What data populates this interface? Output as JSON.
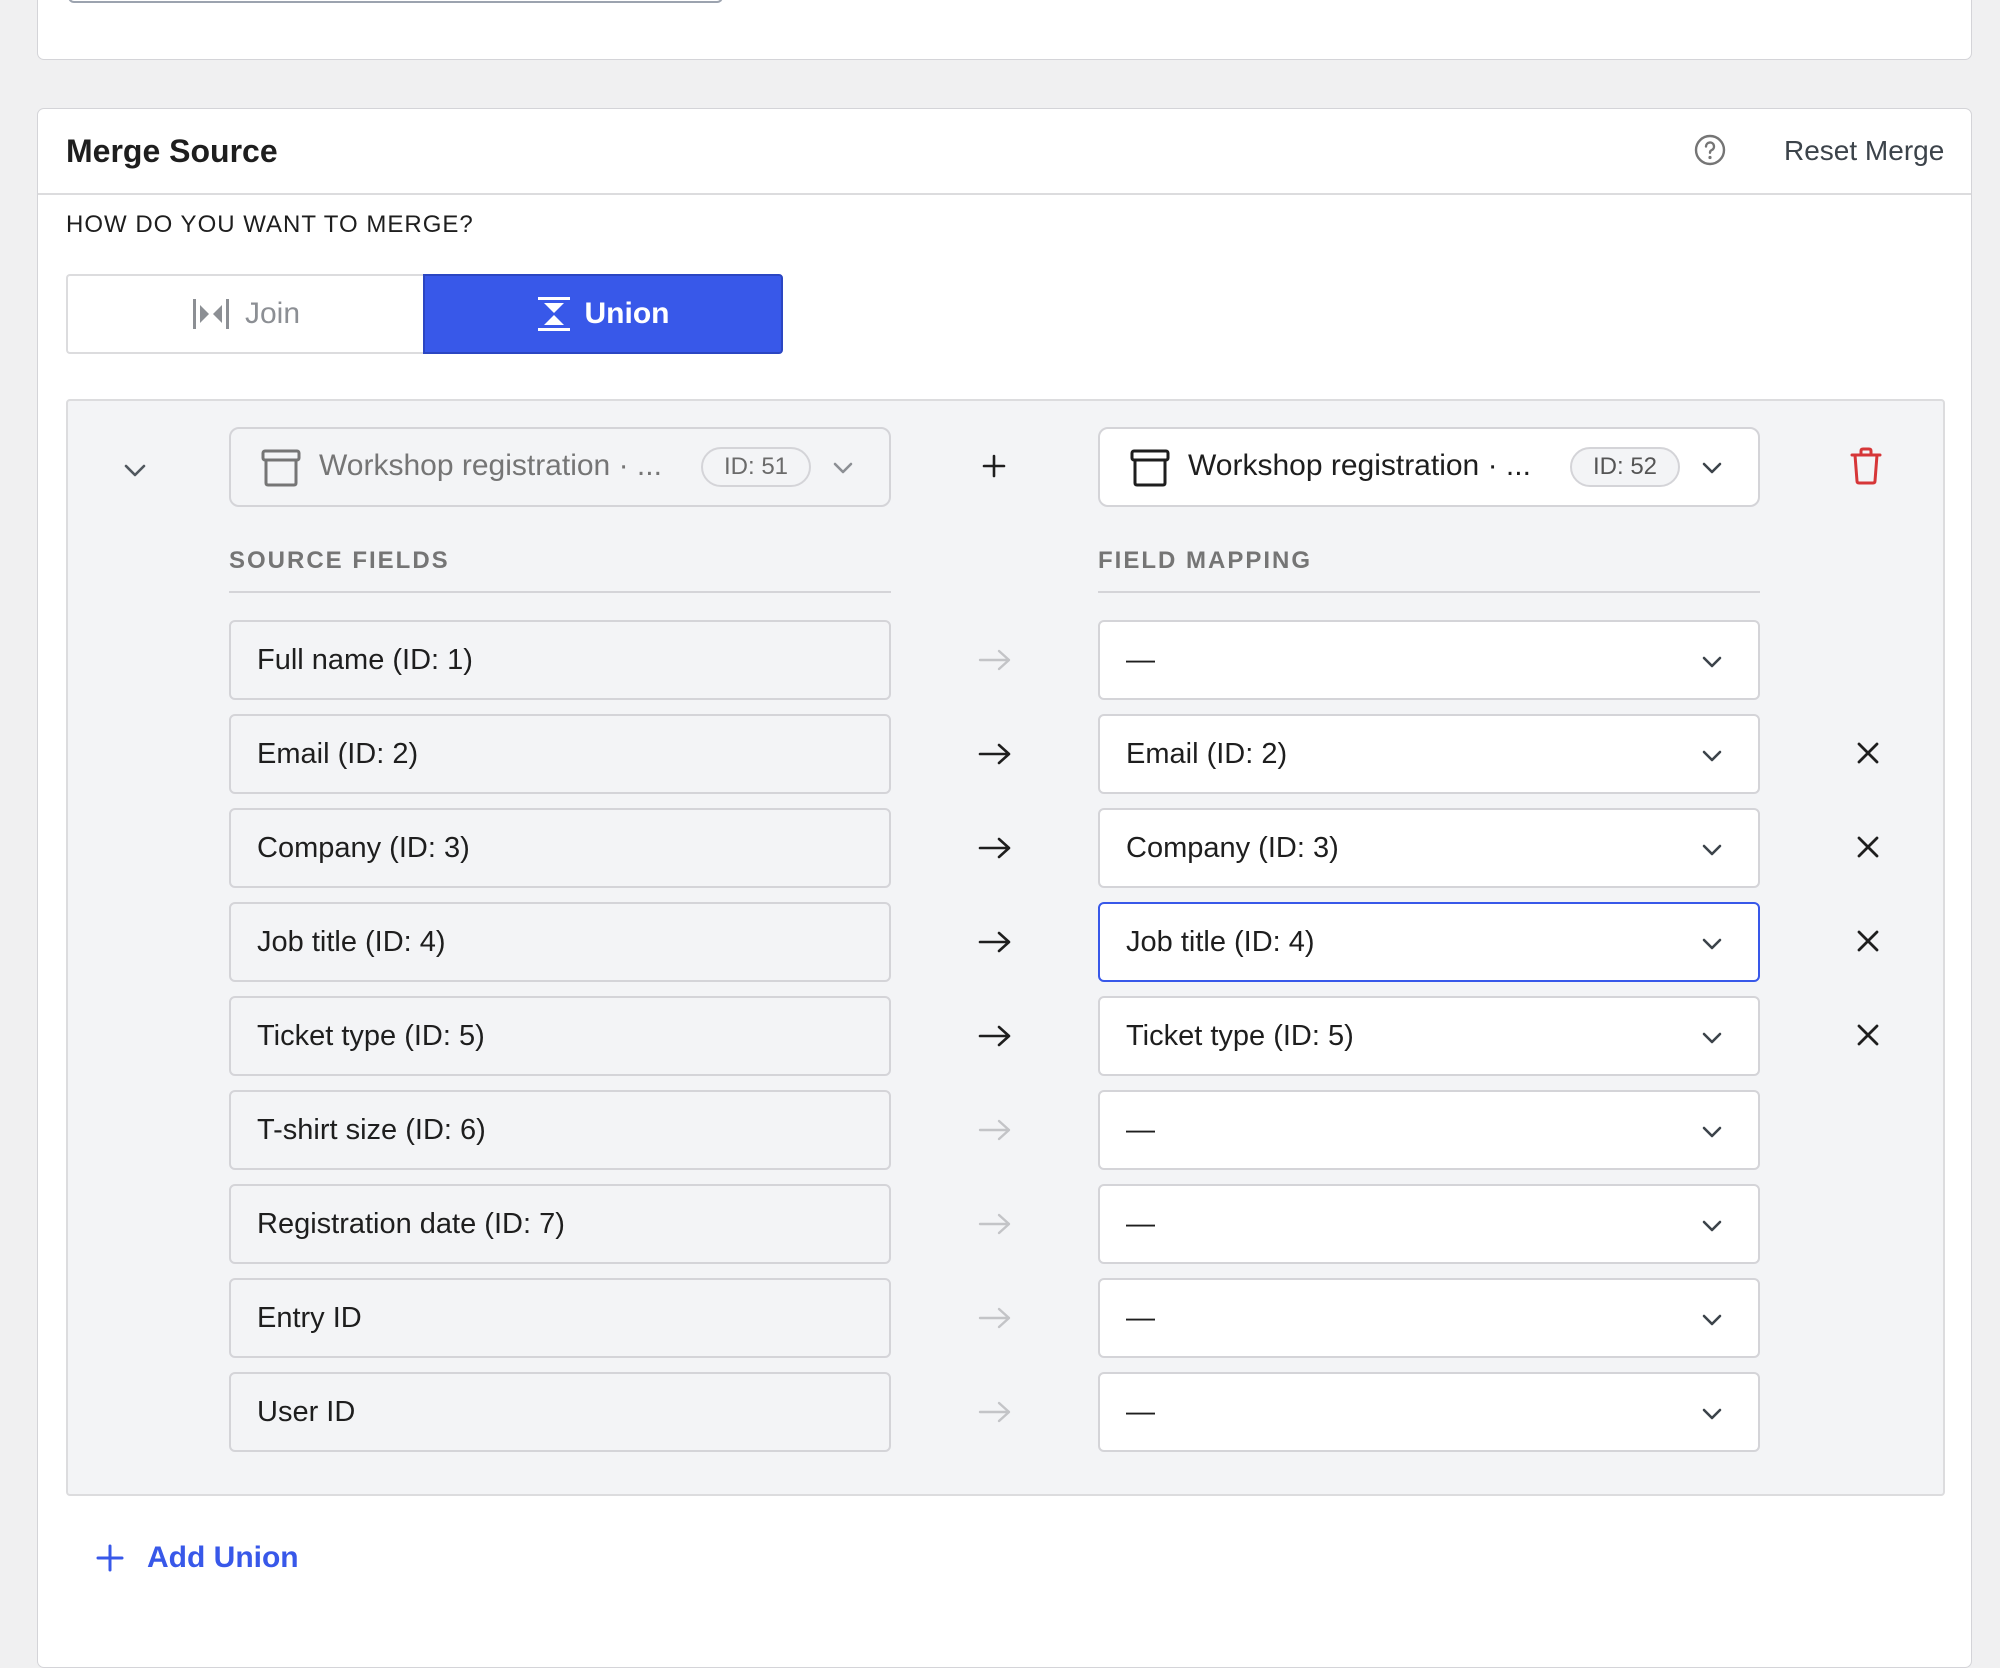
{
  "card": {
    "title": "Merge Source",
    "help_icon": "question-circle-icon",
    "reset_label": "Reset Merge"
  },
  "merge": {
    "question": "HOW DO YOU WANT TO MERGE?",
    "options": [
      {
        "label": "Join",
        "icon": "join-icon",
        "selected": false
      },
      {
        "label": "Union",
        "icon": "union-icon",
        "selected": true
      }
    ]
  },
  "union": {
    "source_form": {
      "name": "Workshop registration · ...",
      "id_badge": "ID: 51",
      "icon": "form-box-icon"
    },
    "operator": "+",
    "target_form": {
      "name": "Workshop registration · ...",
      "id_badge": "ID: 52",
      "icon": "form-box-icon"
    },
    "delete_icon": "trash-icon",
    "source_fields_header": "SOURCE FIELDS",
    "field_mapping_header": "FIELD MAPPING",
    "rows": [
      {
        "source": "Full name (ID: 1)",
        "mapping": "—",
        "mapped": false
      },
      {
        "source": "Email (ID: 2)",
        "mapping": "Email (ID: 2)",
        "mapped": true
      },
      {
        "source": "Company (ID: 3)",
        "mapping": "Company (ID: 3)",
        "mapped": true
      },
      {
        "source": "Job title (ID: 4)",
        "mapping": "Job title (ID: 4)",
        "mapped": true,
        "focused": true
      },
      {
        "source": "Ticket type (ID: 5)",
        "mapping": "Ticket type (ID: 5)",
        "mapped": true
      },
      {
        "source": "T-shirt size (ID: 6)",
        "mapping": "—",
        "mapped": false
      },
      {
        "source": "Registration date (ID: 7)",
        "mapping": "—",
        "mapped": false
      },
      {
        "source": "Entry ID",
        "mapping": "—",
        "mapped": false
      },
      {
        "source": "User ID",
        "mapping": "—",
        "mapped": false
      }
    ]
  },
  "add_union_label": "Add Union",
  "colors": {
    "accent": "#3858e9",
    "danger": "#d63638",
    "background": "#f0f0f1"
  }
}
